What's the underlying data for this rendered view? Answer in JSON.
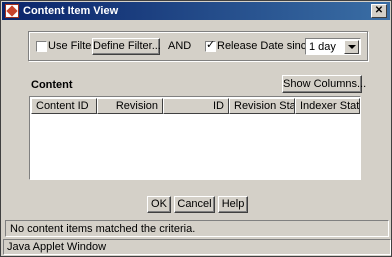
{
  "window": {
    "title": "Content Item View"
  },
  "filter": {
    "use_filter_label": "Use Filter",
    "use_filter_checked": false,
    "define_filter_label": "Define Filter...",
    "and_label": "AND",
    "release_date_label": "Release Date since:",
    "release_date_checked": true,
    "release_date_value": "1 day"
  },
  "content": {
    "section_label": "Content",
    "show_columns_label": "Show Columns...",
    "columns": [
      "Content ID",
      "Revision",
      "ID",
      "Revision Sta...",
      "Indexer Status"
    ],
    "rows": []
  },
  "actions": {
    "ok_label": "OK",
    "cancel_label": "Cancel",
    "help_label": "Help"
  },
  "status": {
    "message": "No content items matched the criteria.",
    "footer": "Java Applet Window"
  },
  "icons": {
    "app": "app-icon",
    "close": "close-icon",
    "check": "checkmark-icon",
    "dropdown": "chevron-down-icon"
  }
}
